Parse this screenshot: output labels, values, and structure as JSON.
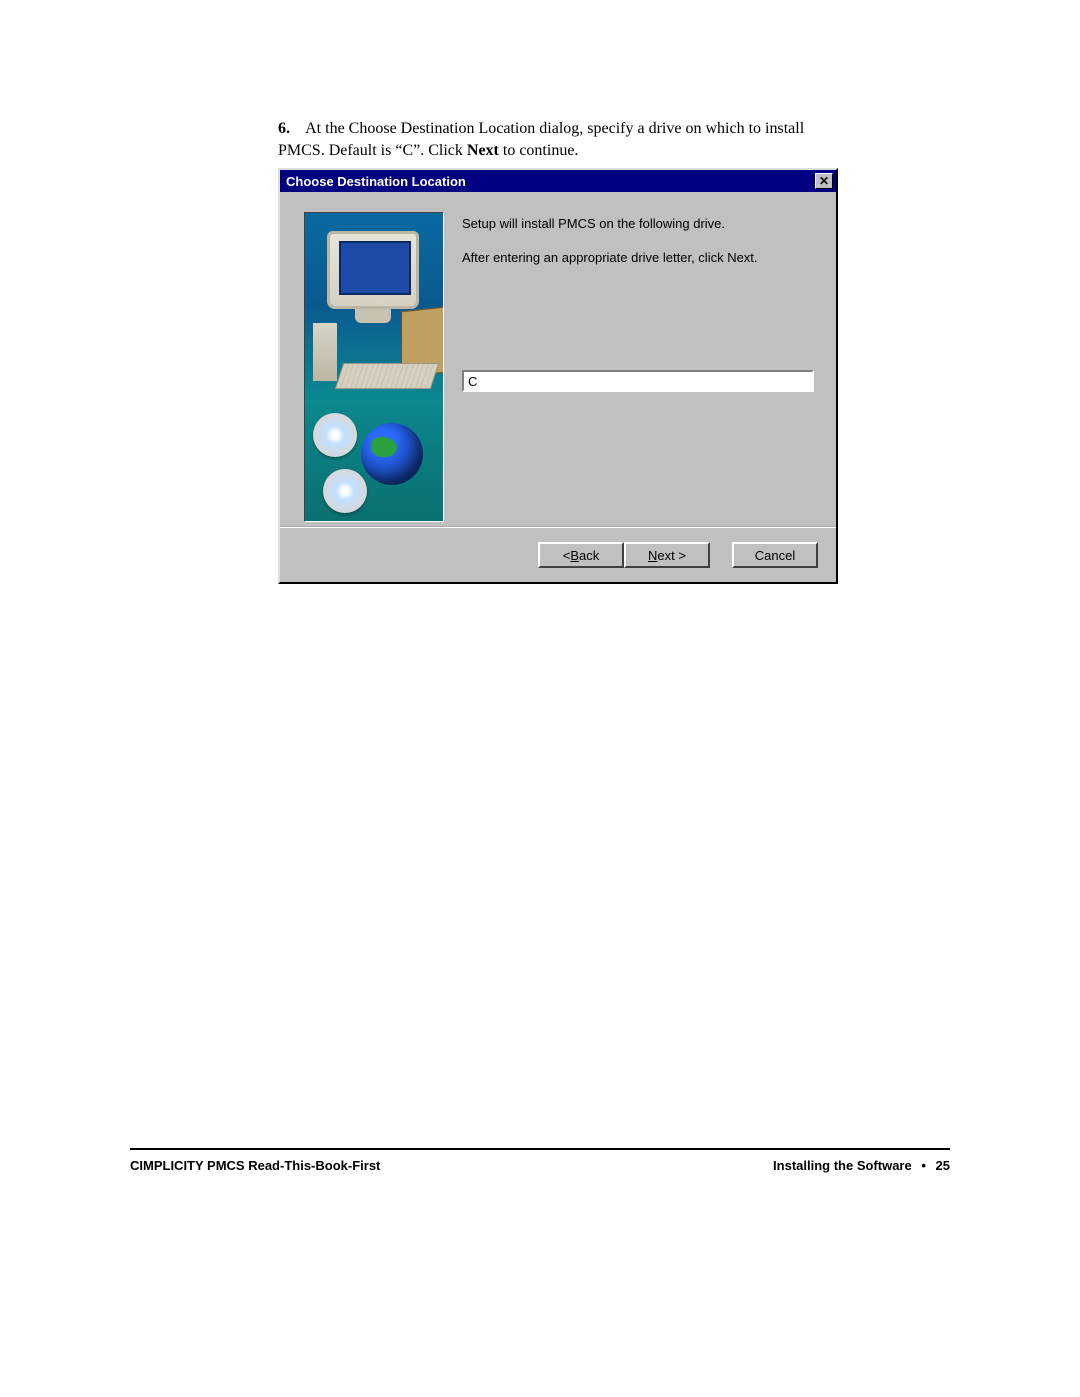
{
  "step": {
    "number": "6.",
    "text_before_bold": "At the Choose Destination Location dialog, specify a drive on which to install PMCS. Default is “C”. Click ",
    "bold_word": "Next",
    "text_after_bold": " to continue."
  },
  "dialog": {
    "title": "Choose Destination Location",
    "close_glyph": "✕",
    "msg_line1": "Setup will install PMCS on the following drive.",
    "msg_line2": "After entering an appropriate drive letter, click Next.",
    "drive_value": "C",
    "buttons": {
      "back_prefix": "< ",
      "back_ul": "B",
      "back_suffix": "ack",
      "next_ul": "N",
      "next_suffix": "ext >",
      "cancel": "Cancel"
    }
  },
  "footer": {
    "left": "CIMPLICITY PMCS Read-This-Book-First",
    "right_section": "Installing the Software",
    "dot": "•",
    "page": "25"
  }
}
